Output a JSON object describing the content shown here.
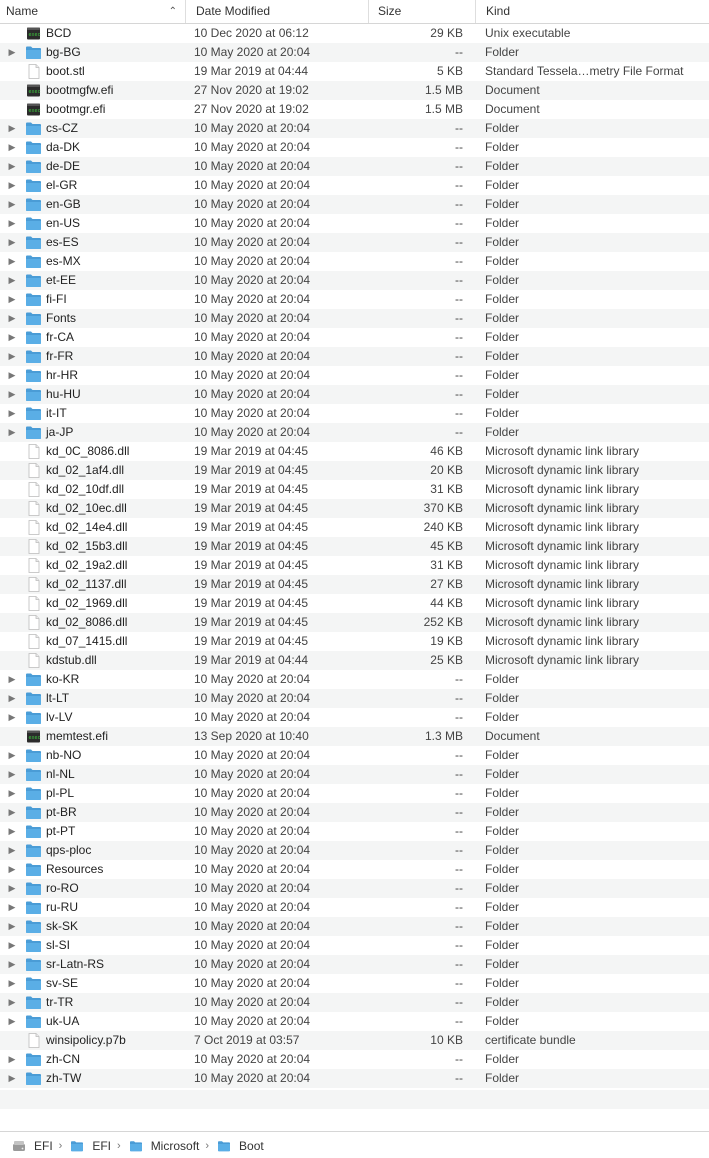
{
  "columns": {
    "name": "Name",
    "date": "Date Modified",
    "size": "Size",
    "kind": "Kind"
  },
  "files": [
    {
      "name": "BCD",
      "date": "10 Dec 2020 at 06:12",
      "size": "29 KB",
      "kind": "Unix executable",
      "icon": "exec-icon",
      "expandable": false
    },
    {
      "name": "bg-BG",
      "date": "10 May 2020 at 20:04",
      "size": "--",
      "kind": "Folder",
      "icon": "folder-icon",
      "expandable": true
    },
    {
      "name": "boot.stl",
      "date": "19 Mar 2019 at 04:44",
      "size": "5 KB",
      "kind": "Standard Tessela…metry File Format",
      "icon": "document-icon",
      "expandable": false
    },
    {
      "name": "bootmgfw.efi",
      "date": "27 Nov 2020 at 19:02",
      "size": "1.5 MB",
      "kind": "Document",
      "icon": "exec-icon",
      "expandable": false
    },
    {
      "name": "bootmgr.efi",
      "date": "27 Nov 2020 at 19:02",
      "size": "1.5 MB",
      "kind": "Document",
      "icon": "exec-icon",
      "expandable": false
    },
    {
      "name": "cs-CZ",
      "date": "10 May 2020 at 20:04",
      "size": "--",
      "kind": "Folder",
      "icon": "folder-icon",
      "expandable": true
    },
    {
      "name": "da-DK",
      "date": "10 May 2020 at 20:04",
      "size": "--",
      "kind": "Folder",
      "icon": "folder-icon",
      "expandable": true
    },
    {
      "name": "de-DE",
      "date": "10 May 2020 at 20:04",
      "size": "--",
      "kind": "Folder",
      "icon": "folder-icon",
      "expandable": true
    },
    {
      "name": "el-GR",
      "date": "10 May 2020 at 20:04",
      "size": "--",
      "kind": "Folder",
      "icon": "folder-icon",
      "expandable": true
    },
    {
      "name": "en-GB",
      "date": "10 May 2020 at 20:04",
      "size": "--",
      "kind": "Folder",
      "icon": "folder-icon",
      "expandable": true
    },
    {
      "name": "en-US",
      "date": "10 May 2020 at 20:04",
      "size": "--",
      "kind": "Folder",
      "icon": "folder-icon",
      "expandable": true
    },
    {
      "name": "es-ES",
      "date": "10 May 2020 at 20:04",
      "size": "--",
      "kind": "Folder",
      "icon": "folder-icon",
      "expandable": true
    },
    {
      "name": "es-MX",
      "date": "10 May 2020 at 20:04",
      "size": "--",
      "kind": "Folder",
      "icon": "folder-icon",
      "expandable": true
    },
    {
      "name": "et-EE",
      "date": "10 May 2020 at 20:04",
      "size": "--",
      "kind": "Folder",
      "icon": "folder-icon",
      "expandable": true
    },
    {
      "name": "fi-FI",
      "date": "10 May 2020 at 20:04",
      "size": "--",
      "kind": "Folder",
      "icon": "folder-icon",
      "expandable": true
    },
    {
      "name": "Fonts",
      "date": "10 May 2020 at 20:04",
      "size": "--",
      "kind": "Folder",
      "icon": "folder-icon",
      "expandable": true
    },
    {
      "name": "fr-CA",
      "date": "10 May 2020 at 20:04",
      "size": "--",
      "kind": "Folder",
      "icon": "folder-icon",
      "expandable": true
    },
    {
      "name": "fr-FR",
      "date": "10 May 2020 at 20:04",
      "size": "--",
      "kind": "Folder",
      "icon": "folder-icon",
      "expandable": true
    },
    {
      "name": "hr-HR",
      "date": "10 May 2020 at 20:04",
      "size": "--",
      "kind": "Folder",
      "icon": "folder-icon",
      "expandable": true
    },
    {
      "name": "hu-HU",
      "date": "10 May 2020 at 20:04",
      "size": "--",
      "kind": "Folder",
      "icon": "folder-icon",
      "expandable": true
    },
    {
      "name": "it-IT",
      "date": "10 May 2020 at 20:04",
      "size": "--",
      "kind": "Folder",
      "icon": "folder-icon",
      "expandable": true
    },
    {
      "name": "ja-JP",
      "date": "10 May 2020 at 20:04",
      "size": "--",
      "kind": "Folder",
      "icon": "folder-icon",
      "expandable": true
    },
    {
      "name": "kd_0C_8086.dll",
      "date": "19 Mar 2019 at 04:45",
      "size": "46 KB",
      "kind": "Microsoft dynamic link library",
      "icon": "document-icon",
      "expandable": false
    },
    {
      "name": "kd_02_1af4.dll",
      "date": "19 Mar 2019 at 04:45",
      "size": "20 KB",
      "kind": "Microsoft dynamic link library",
      "icon": "document-icon",
      "expandable": false
    },
    {
      "name": "kd_02_10df.dll",
      "date": "19 Mar 2019 at 04:45",
      "size": "31 KB",
      "kind": "Microsoft dynamic link library",
      "icon": "document-icon",
      "expandable": false
    },
    {
      "name": "kd_02_10ec.dll",
      "date": "19 Mar 2019 at 04:45",
      "size": "370 KB",
      "kind": "Microsoft dynamic link library",
      "icon": "document-icon",
      "expandable": false
    },
    {
      "name": "kd_02_14e4.dll",
      "date": "19 Mar 2019 at 04:45",
      "size": "240 KB",
      "kind": "Microsoft dynamic link library",
      "icon": "document-icon",
      "expandable": false
    },
    {
      "name": "kd_02_15b3.dll",
      "date": "19 Mar 2019 at 04:45",
      "size": "45 KB",
      "kind": "Microsoft dynamic link library",
      "icon": "document-icon",
      "expandable": false
    },
    {
      "name": "kd_02_19a2.dll",
      "date": "19 Mar 2019 at 04:45",
      "size": "31 KB",
      "kind": "Microsoft dynamic link library",
      "icon": "document-icon",
      "expandable": false
    },
    {
      "name": "kd_02_1137.dll",
      "date": "19 Mar 2019 at 04:45",
      "size": "27 KB",
      "kind": "Microsoft dynamic link library",
      "icon": "document-icon",
      "expandable": false
    },
    {
      "name": "kd_02_1969.dll",
      "date": "19 Mar 2019 at 04:45",
      "size": "44 KB",
      "kind": "Microsoft dynamic link library",
      "icon": "document-icon",
      "expandable": false
    },
    {
      "name": "kd_02_8086.dll",
      "date": "19 Mar 2019 at 04:45",
      "size": "252 KB",
      "kind": "Microsoft dynamic link library",
      "icon": "document-icon",
      "expandable": false
    },
    {
      "name": "kd_07_1415.dll",
      "date": "19 Mar 2019 at 04:45",
      "size": "19 KB",
      "kind": "Microsoft dynamic link library",
      "icon": "document-icon",
      "expandable": false
    },
    {
      "name": "kdstub.dll",
      "date": "19 Mar 2019 at 04:44",
      "size": "25 KB",
      "kind": "Microsoft dynamic link library",
      "icon": "document-icon",
      "expandable": false
    },
    {
      "name": "ko-KR",
      "date": "10 May 2020 at 20:04",
      "size": "--",
      "kind": "Folder",
      "icon": "folder-icon",
      "expandable": true
    },
    {
      "name": "lt-LT",
      "date": "10 May 2020 at 20:04",
      "size": "--",
      "kind": "Folder",
      "icon": "folder-icon",
      "expandable": true
    },
    {
      "name": "lv-LV",
      "date": "10 May 2020 at 20:04",
      "size": "--",
      "kind": "Folder",
      "icon": "folder-icon",
      "expandable": true
    },
    {
      "name": "memtest.efi",
      "date": "13 Sep 2020 at 10:40",
      "size": "1.3 MB",
      "kind": "Document",
      "icon": "exec-icon",
      "expandable": false
    },
    {
      "name": "nb-NO",
      "date": "10 May 2020 at 20:04",
      "size": "--",
      "kind": "Folder",
      "icon": "folder-icon",
      "expandable": true
    },
    {
      "name": "nl-NL",
      "date": "10 May 2020 at 20:04",
      "size": "--",
      "kind": "Folder",
      "icon": "folder-icon",
      "expandable": true
    },
    {
      "name": "pl-PL",
      "date": "10 May 2020 at 20:04",
      "size": "--",
      "kind": "Folder",
      "icon": "folder-icon",
      "expandable": true
    },
    {
      "name": "pt-BR",
      "date": "10 May 2020 at 20:04",
      "size": "--",
      "kind": "Folder",
      "icon": "folder-icon",
      "expandable": true
    },
    {
      "name": "pt-PT",
      "date": "10 May 2020 at 20:04",
      "size": "--",
      "kind": "Folder",
      "icon": "folder-icon",
      "expandable": true
    },
    {
      "name": "qps-ploc",
      "date": "10 May 2020 at 20:04",
      "size": "--",
      "kind": "Folder",
      "icon": "folder-icon",
      "expandable": true
    },
    {
      "name": "Resources",
      "date": "10 May 2020 at 20:04",
      "size": "--",
      "kind": "Folder",
      "icon": "folder-icon",
      "expandable": true
    },
    {
      "name": "ro-RO",
      "date": "10 May 2020 at 20:04",
      "size": "--",
      "kind": "Folder",
      "icon": "folder-icon",
      "expandable": true
    },
    {
      "name": "ru-RU",
      "date": "10 May 2020 at 20:04",
      "size": "--",
      "kind": "Folder",
      "icon": "folder-icon",
      "expandable": true
    },
    {
      "name": "sk-SK",
      "date": "10 May 2020 at 20:04",
      "size": "--",
      "kind": "Folder",
      "icon": "folder-icon",
      "expandable": true
    },
    {
      "name": "sl-SI",
      "date": "10 May 2020 at 20:04",
      "size": "--",
      "kind": "Folder",
      "icon": "folder-icon",
      "expandable": true
    },
    {
      "name": "sr-Latn-RS",
      "date": "10 May 2020 at 20:04",
      "size": "--",
      "kind": "Folder",
      "icon": "folder-icon",
      "expandable": true
    },
    {
      "name": "sv-SE",
      "date": "10 May 2020 at 20:04",
      "size": "--",
      "kind": "Folder",
      "icon": "folder-icon",
      "expandable": true
    },
    {
      "name": "tr-TR",
      "date": "10 May 2020 at 20:04",
      "size": "--",
      "kind": "Folder",
      "icon": "folder-icon",
      "expandable": true
    },
    {
      "name": "uk-UA",
      "date": "10 May 2020 at 20:04",
      "size": "--",
      "kind": "Folder",
      "icon": "folder-icon",
      "expandable": true
    },
    {
      "name": "winsipolicy.p7b",
      "date": "7 Oct 2019 at 03:57",
      "size": "10 KB",
      "kind": "certificate bundle",
      "icon": "document-icon",
      "expandable": false
    },
    {
      "name": "zh-CN",
      "date": "10 May 2020 at 20:04",
      "size": "--",
      "kind": "Folder",
      "icon": "folder-icon",
      "expandable": true
    },
    {
      "name": "zh-TW",
      "date": "10 May 2020 at 20:04",
      "size": "--",
      "kind": "Folder",
      "icon": "folder-icon",
      "expandable": true
    }
  ],
  "pathbar": [
    {
      "label": "EFI",
      "icon": "drive-icon"
    },
    {
      "label": "EFI",
      "icon": "folder-icon"
    },
    {
      "label": "Microsoft",
      "icon": "folder-icon"
    },
    {
      "label": "Boot",
      "icon": "folder-icon"
    }
  ],
  "colors": {
    "folder": "#5aaee6",
    "folder_tab": "#4a9cd6",
    "row_alt": "#f4f5f5"
  }
}
